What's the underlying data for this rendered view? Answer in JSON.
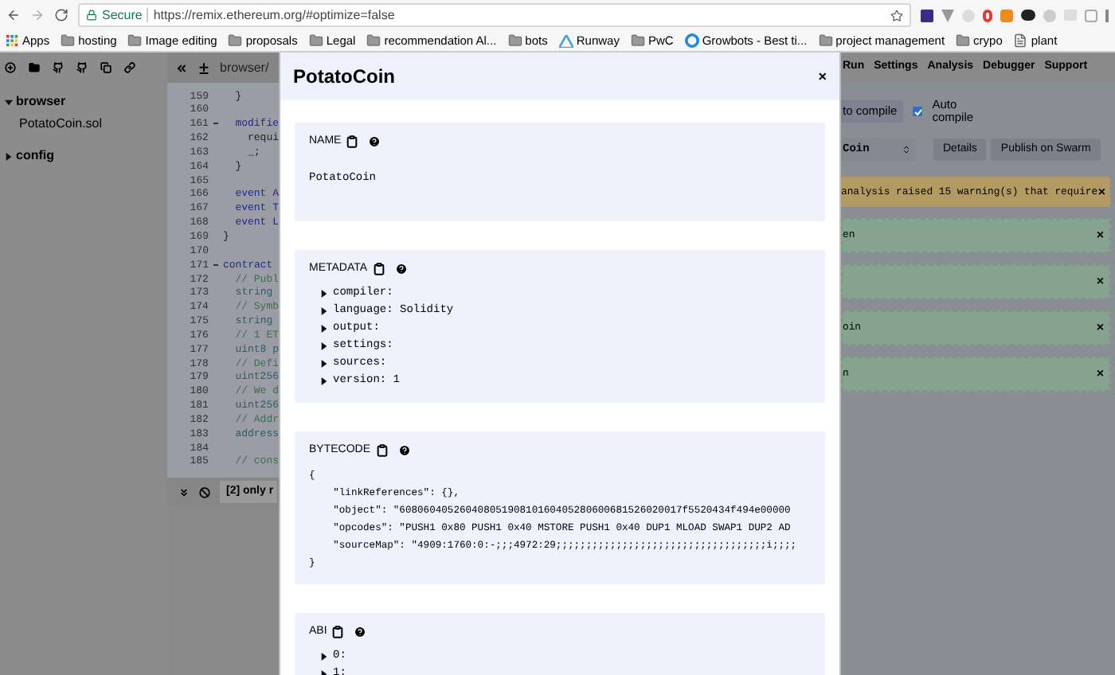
{
  "browser": {
    "security": "Secure",
    "url": "https://remix.ethereum.org/#optimize=false",
    "bookmarks": [
      {
        "label": "Apps",
        "kind": "apps"
      },
      {
        "label": "hosting",
        "kind": "folder"
      },
      {
        "label": "Image editing",
        "kind": "folder"
      },
      {
        "label": "proposals",
        "kind": "folder"
      },
      {
        "label": "Legal",
        "kind": "folder"
      },
      {
        "label": "recommendation Al...",
        "kind": "folder"
      },
      {
        "label": "bots",
        "kind": "folder"
      },
      {
        "label": "Runway",
        "kind": "triangle"
      },
      {
        "label": "PwC",
        "kind": "folder"
      },
      {
        "label": "Growbots - Best ti...",
        "kind": "circle"
      },
      {
        "label": "project management",
        "kind": "folder"
      },
      {
        "label": "crypo",
        "kind": "folder"
      },
      {
        "label": "plant",
        "kind": "page"
      }
    ]
  },
  "explorer": {
    "tree": [
      {
        "label": "browser",
        "expanded": true,
        "children": [
          {
            "label": "PotatoCoin.sol"
          }
        ]
      },
      {
        "label": "config",
        "expanded": false
      }
    ]
  },
  "editor": {
    "tab": "browser/",
    "terminal": "[2] only r",
    "lines": [
      {
        "number": "159",
        "code": "  }",
        "kind": "plain",
        "foldable": false
      },
      {
        "number": "160",
        "foldable": false
      },
      {
        "number": "161",
        "code": "  modifie",
        "kind": "keyword",
        "foldable": true
      },
      {
        "number": "162",
        "code": "    requi",
        "kind": "plain",
        "foldable": false
      },
      {
        "number": "163",
        "code": "    _;",
        "kind": "plain",
        "foldable": false
      },
      {
        "number": "164",
        "code": "  }",
        "kind": "plain",
        "foldable": false
      },
      {
        "number": "165",
        "foldable": false
      },
      {
        "number": "166",
        "code": "  event A",
        "kind": "keyword",
        "foldable": false
      },
      {
        "number": "167",
        "code": "  event T",
        "kind": "keyword",
        "foldable": false
      },
      {
        "number": "168",
        "code": "  event L",
        "kind": "keyword",
        "foldable": false
      },
      {
        "number": "169",
        "code": "}",
        "kind": "plain",
        "foldable": false
      },
      {
        "number": "170",
        "foldable": false
      },
      {
        "number": "171",
        "code": "contract",
        "kind": "keyword",
        "foldable": true
      },
      {
        "number": "172",
        "code": "  // Publ",
        "kind": "comment",
        "foldable": false
      },
      {
        "number": "173",
        "code": "  string",
        "kind": "type",
        "foldable": false
      },
      {
        "number": "174",
        "code": "  // Symb",
        "kind": "comment",
        "foldable": false
      },
      {
        "number": "175",
        "code": "  string",
        "kind": "type",
        "foldable": false
      },
      {
        "number": "176",
        "code": "  // 1 ET",
        "kind": "comment",
        "foldable": false
      },
      {
        "number": "177",
        "code": "  uint8 p",
        "kind": "type",
        "foldable": false
      },
      {
        "number": "178",
        "code": "  // Defi",
        "kind": "comment",
        "foldable": false
      },
      {
        "number": "179",
        "code": "  uint256",
        "kind": "type",
        "foldable": false
      },
      {
        "number": "180",
        "code": "  // We d",
        "kind": "comment",
        "foldable": false
      },
      {
        "number": "181",
        "code": "  uint256",
        "kind": "type",
        "foldable": false
      },
      {
        "number": "182",
        "code": "  // Addr",
        "kind": "comment",
        "foldable": false
      },
      {
        "number": "183",
        "code": "  address",
        "kind": "type",
        "foldable": false
      },
      {
        "number": "184",
        "foldable": false
      },
      {
        "number": "185",
        "code": "  // cons",
        "kind": "comment",
        "foldable": false
      }
    ]
  },
  "right_panel": {
    "tabs": [
      "Run",
      "Settings",
      "Analysis",
      "Debugger",
      "Support"
    ],
    "compile_button": "to compile",
    "auto_compile": {
      "label": "Auto compile",
      "checked": true
    },
    "contract_select": "Coin",
    "buttons": [
      "Details",
      "Publish on Swarm"
    ],
    "alerts": [
      {
        "kind": "warning",
        "text": "analysis raised 15 warning(s) that require",
        "close": "×"
      },
      {
        "kind": "success",
        "text": "en",
        "close": "×"
      },
      {
        "kind": "success",
        "close": "×"
      },
      {
        "kind": "success",
        "text": "oin",
        "close": "×"
      },
      {
        "kind": "success",
        "text": "n",
        "close": "×"
      }
    ]
  },
  "modal": {
    "title": "PotatoCoin",
    "close": "×",
    "sections": [
      {
        "title": "NAME",
        "kind": "text",
        "value": "PotatoCoin"
      },
      {
        "title": "METADATA",
        "kind": "tree",
        "items": [
          "compiler:",
          "language: Solidity",
          "output:",
          "settings:",
          "sources:",
          "version: 1"
        ]
      },
      {
        "title": "BYTECODE",
        "kind": "json",
        "lines": [
          "{",
          "    \"linkReferences\": {},",
          "    \"object\": \"60806040526040805190810160405280600681526020017f5520434f494e00000",
          "    \"opcodes\": \"PUSH1 0x80 PUSH1 0x40 MSTORE PUSH1 0x40 DUP1 MLOAD SWAP1 DUP2 AD",
          "    \"sourceMap\": \"4909:1760:0:-;;;4972:29;;;;;;;;;;;;;;;;;;;;;;;;;;;;;;;;;;;i;;;;",
          "}"
        ]
      },
      {
        "title": "ABI",
        "kind": "tree",
        "items": [
          "0:",
          "1:"
        ]
      }
    ]
  }
}
